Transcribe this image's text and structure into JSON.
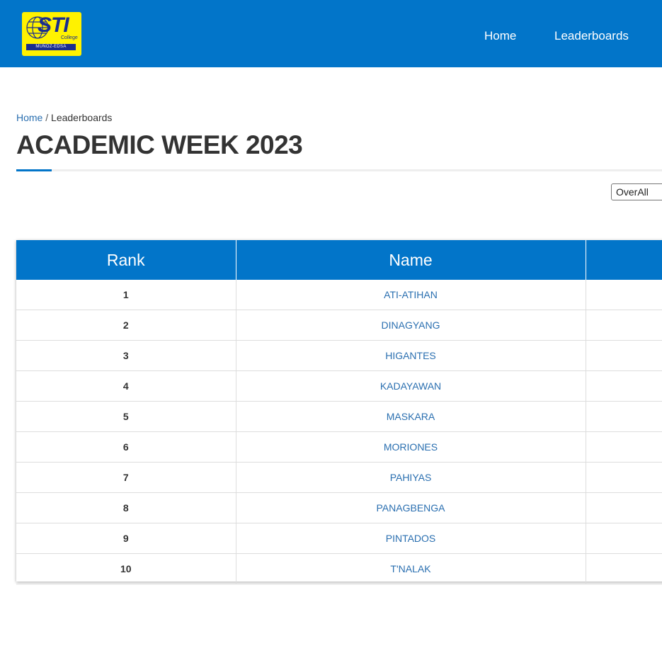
{
  "navbar": {
    "logo": {
      "mark": "STI",
      "college": "College",
      "campus": "MUÑOZ-EDSA"
    },
    "links": {
      "home": "Home",
      "leaderboards": "Leaderboards"
    },
    "colors": {
      "brand_blue": "#0275c9",
      "logo_yellow": "#fff200"
    }
  },
  "breadcrumb": {
    "home": "Home",
    "separator": "/",
    "current": "Leaderboards"
  },
  "page": {
    "title": "ACADEMIC WEEK 2023"
  },
  "filter": {
    "selected": "OverAll"
  },
  "table": {
    "headers": [
      "Rank",
      "Name",
      ""
    ],
    "rows": [
      {
        "rank": "1",
        "name": "ATI-ATIHAN"
      },
      {
        "rank": "2",
        "name": "DINAGYANG"
      },
      {
        "rank": "3",
        "name": "HIGANTES"
      },
      {
        "rank": "4",
        "name": "KADAYAWAN"
      },
      {
        "rank": "5",
        "name": "MASKARA"
      },
      {
        "rank": "6",
        "name": "MORIONES"
      },
      {
        "rank": "7",
        "name": "PAHIYAS"
      },
      {
        "rank": "8",
        "name": "PANAGBENGA"
      },
      {
        "rank": "9",
        "name": "PINTADOS"
      },
      {
        "rank": "10",
        "name": "T'NALAK"
      }
    ]
  }
}
